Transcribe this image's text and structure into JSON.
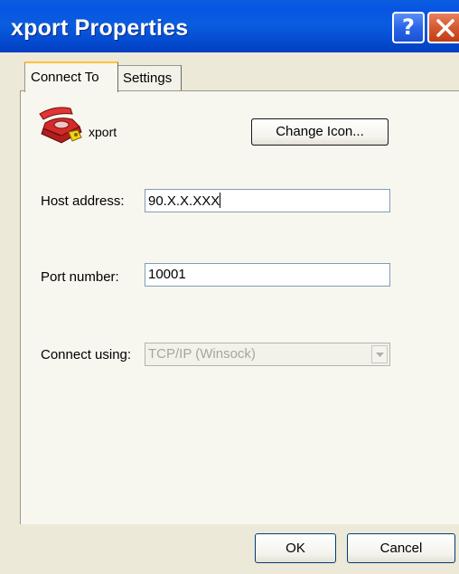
{
  "window": {
    "title": "xport Properties",
    "help_glyph": "?"
  },
  "tabs": [
    {
      "label": "Connect To",
      "active": true
    },
    {
      "label": "Settings",
      "active": false
    }
  ],
  "connection": {
    "name": "xport",
    "icon": "phone-icon",
    "change_icon_label": "Change Icon...",
    "host_address_label": "Host address:",
    "host_address_value": "90.X.X.XXX",
    "port_number_label": "Port number:",
    "port_number_value": "10001",
    "connect_using_label": "Connect using:",
    "connect_using_value": "TCP/IP (Winsock)"
  },
  "buttons": {
    "ok": "OK",
    "cancel": "Cancel"
  },
  "colors": {
    "titlebar": "#0a5ddf",
    "close_button": "#d55a30",
    "dialog_bg": "#ece9d8",
    "active_tab_highlight": "#ffc23c"
  }
}
